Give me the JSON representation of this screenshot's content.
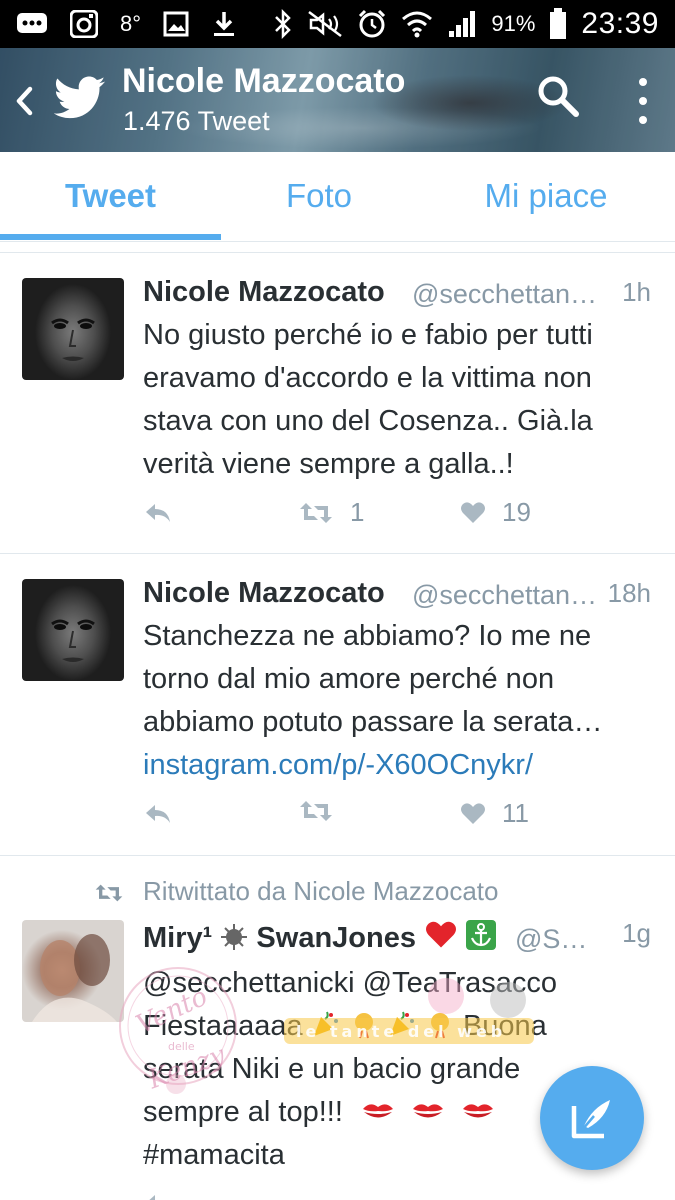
{
  "status_bar": {
    "battery_percent": "91%",
    "time": "23:39",
    "temperature_icon_text": "8°",
    "icons_left": [
      "message-icon",
      "instagram-icon",
      "temperature-icon",
      "image-icon",
      "download-icon"
    ],
    "icons_right": [
      "bluetooth-icon",
      "mute-icon",
      "alarm-icon",
      "wifi-icon",
      "signal-icon",
      "battery-icon"
    ]
  },
  "header": {
    "title": "Nicole Mazzocato",
    "subtitle": "1.476 Tweet",
    "back_icon": "chevron-left-icon",
    "logo_icon": "twitter-bird-icon",
    "search_icon": "search-icon",
    "more_icon": "more-vertical-icon"
  },
  "tabs": [
    {
      "label": "Tweet",
      "active": true
    },
    {
      "label": "Foto",
      "active": false
    },
    {
      "label": "Mi piace",
      "active": false
    }
  ],
  "tweets": [
    {
      "name": "Nicole Mazzocato",
      "handle": "@secchettani…",
      "time": "1h",
      "text_lines": [
        "No giusto perché io e fabio per tutti",
        "eravamo d'accordo e la vittima non",
        "stava con uno del Cosenza.. Già.la",
        "verità viene sempre a galla..!"
      ],
      "retweets": "1",
      "likes": "19"
    },
    {
      "name": "Nicole Mazzocato",
      "handle": "@secchettan…",
      "time": "18h",
      "text_lines": [
        "Stanchezza ne abbiamo? Io me ne",
        "torno dal mio amore perché non",
        "abbiamo potuto passare la serata…"
      ],
      "link": "instagram.com/p/-X60OCnykr/",
      "retweets": "",
      "likes": "11"
    },
    {
      "retweeted_by": "Ritwittato da Nicole Mazzocato",
      "name": "Miry¹",
      "name_suffix": "SwanJones",
      "handle": "@Sm…",
      "time": "1g",
      "text_lines": [
        "@secchettanicki @TeaTrasacco",
        "Fiestaaaaaa",
        "serata Niki e un bacio grande",
        "sempre al top!!!",
        "#mamacita"
      ],
      "line2_suffix": "Buona"
    }
  ],
  "watermark_text": "Vento delle Kenzy",
  "watermark_banner": "le tante del web",
  "colors": {
    "accent": "#55acee",
    "link": "#2b7bb9",
    "muted": "#8899a6",
    "text": "#292f33"
  },
  "fab_icon": "compose-icon"
}
